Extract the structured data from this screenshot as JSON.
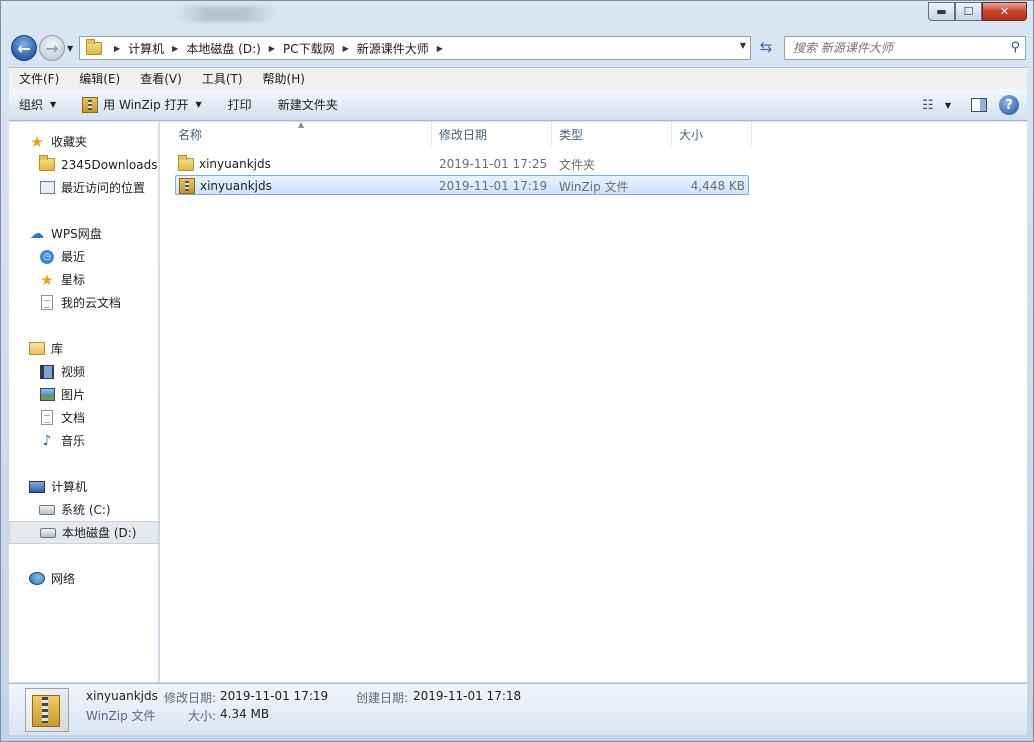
{
  "window": {
    "controls": {
      "minimize": "▬",
      "maximize": "☐",
      "close": "✕"
    }
  },
  "address": {
    "crumbs": [
      "计算机",
      "本地磁盘 (D:)",
      "PC下载网",
      "新源课件大师"
    ],
    "search_placeholder": "搜索 新源课件大师"
  },
  "menu": [
    "文件(F)",
    "编辑(E)",
    "查看(V)",
    "工具(T)",
    "帮助(H)"
  ],
  "toolbar": {
    "organize": "组织",
    "open_with": "用 WinZip 打开",
    "print": "打印",
    "new_folder": "新建文件夹"
  },
  "nav": {
    "favorites": {
      "label": "收藏夹",
      "items": [
        "2345Downloads",
        "最近访问的位置"
      ]
    },
    "wps": {
      "label": "WPS网盘",
      "items": [
        "最近",
        "星标",
        "我的云文档"
      ]
    },
    "libraries": {
      "label": "库",
      "items": [
        "视频",
        "图片",
        "文档",
        "音乐"
      ]
    },
    "computer": {
      "label": "计算机",
      "items": [
        "系统 (C:)",
        "本地磁盘 (D:)"
      ]
    },
    "network": {
      "label": "网络"
    }
  },
  "columns": [
    "名称",
    "修改日期",
    "类型",
    "大小"
  ],
  "files": [
    {
      "name": "xinyuankjds",
      "modified": "2019-11-01 17:25",
      "type": "文件夹",
      "size": ""
    },
    {
      "name": "xinyuankjds",
      "modified": "2019-11-01 17:19",
      "type": "WinZip 文件",
      "size": "4,448 KB"
    }
  ],
  "details": {
    "name": "xinyuankjds",
    "type": "WinZip 文件",
    "modified_label": "修改日期:",
    "modified": "2019-11-01 17:19",
    "created_label": "创建日期:",
    "created": "2019-11-01 17:18",
    "size_label": "大小:",
    "size": "4.34 MB"
  }
}
